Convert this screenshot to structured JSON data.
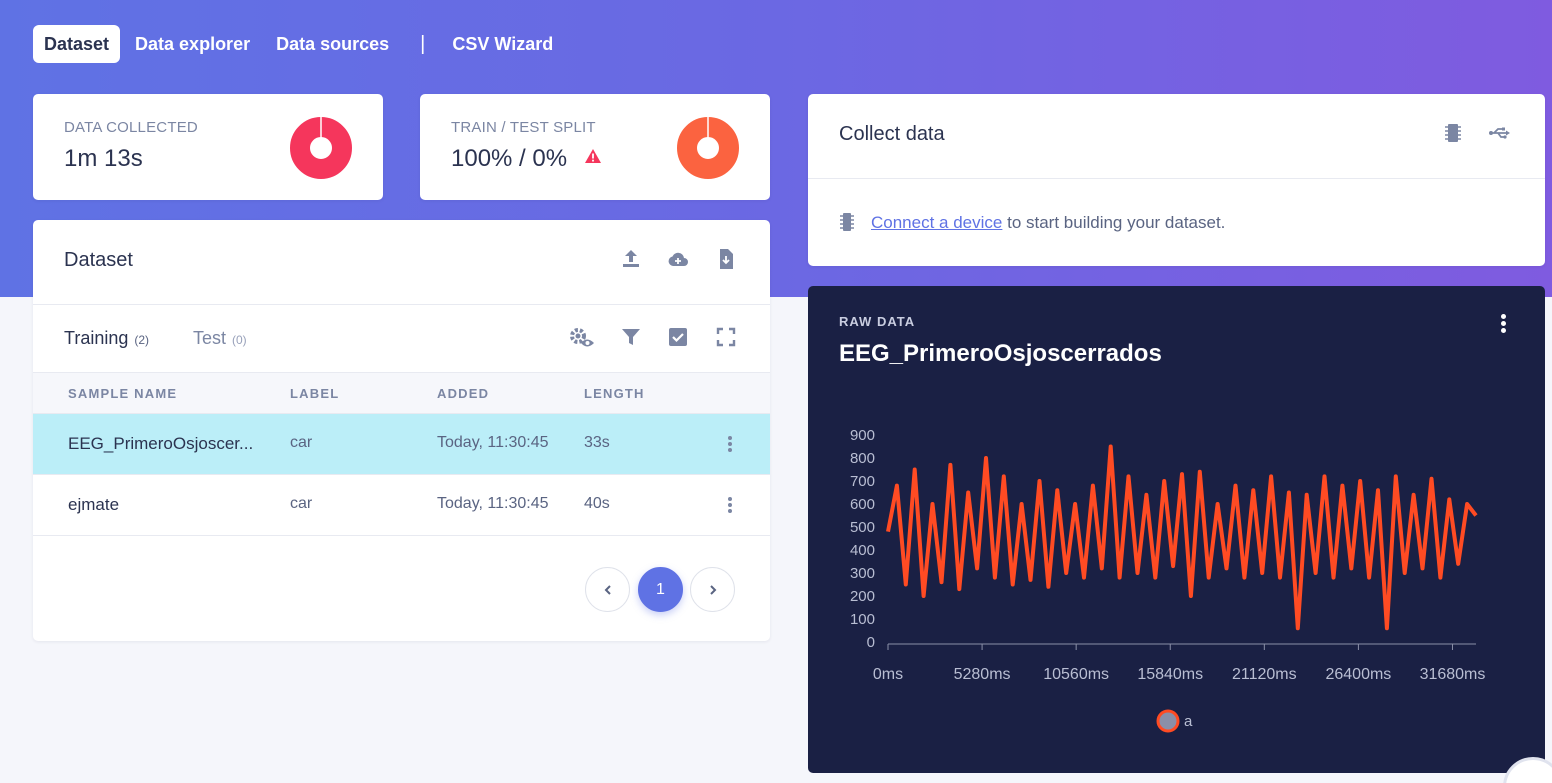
{
  "nav": {
    "tabs": [
      {
        "label": "Dataset",
        "active": true
      },
      {
        "label": "Data explorer",
        "active": false
      },
      {
        "label": "Data sources",
        "active": false
      },
      {
        "label": "CSV Wizard",
        "active": false
      }
    ],
    "separator": "|"
  },
  "stats": {
    "collected": {
      "label": "DATA COLLECTED",
      "value": "1m 13s",
      "color": "#f5365c"
    },
    "split": {
      "label": "TRAIN / TEST SPLIT",
      "value": "100% / 0%",
      "color": "#fb6340",
      "warning_color": "#f5365c"
    }
  },
  "dataset": {
    "title": "Dataset",
    "icons": [
      "upload-icon",
      "cloud-add-icon",
      "file-download-icon"
    ],
    "tabs": {
      "training": {
        "label": "Training",
        "count": "(2)"
      },
      "test": {
        "label": "Test",
        "count": "(0)"
      }
    },
    "toolbar_icons": [
      "settings-eye-icon",
      "filter-icon",
      "checkbox-icon",
      "fullscreen-icon"
    ],
    "columns": [
      "SAMPLE NAME",
      "LABEL",
      "ADDED",
      "LENGTH"
    ],
    "rows": [
      {
        "name": "EEG_PrimeroOsjoscer...",
        "label": "car",
        "added": "Today, 11:30:45",
        "length": "33s",
        "selected": true
      },
      {
        "name": "ejmate",
        "label": "car",
        "added": "Today, 11:30:45",
        "length": "40s",
        "selected": false
      }
    ],
    "pagination": {
      "current": "1"
    }
  },
  "collect": {
    "title": "Collect data",
    "icons": [
      "chip-icon",
      "usb-icon"
    ],
    "link_text": "Connect a device",
    "message": " to start building your dataset."
  },
  "raw": {
    "label": "RAW DATA",
    "title": "EEG_PrimeroOsjoscerrados"
  },
  "chart_data": {
    "type": "line",
    "title": "EEG_PrimeroOsjoscerrados",
    "xlabel": "",
    "ylabel": "",
    "ylim": [
      0,
      900
    ],
    "xlim": [
      0,
      33000
    ],
    "y_ticks": [
      "900",
      "800",
      "700",
      "600",
      "500",
      "400",
      "300",
      "200",
      "100",
      "0"
    ],
    "x_ticks": [
      "0ms",
      "5280ms",
      "10560ms",
      "15840ms",
      "21120ms",
      "26400ms",
      "31680ms"
    ],
    "series": [
      {
        "name": "a",
        "color": "#ff4b23",
        "x": [
          0,
          500,
          1000,
          1500,
          2000,
          2500,
          3000,
          3500,
          4000,
          4500,
          5000,
          5500,
          6000,
          6500,
          7000,
          7500,
          8000,
          8500,
          9000,
          9500,
          10000,
          10500,
          11000,
          11500,
          12000,
          12500,
          13000,
          13500,
          14000,
          14500,
          15000,
          15500,
          16000,
          16500,
          17000,
          17500,
          18000,
          18500,
          19000,
          19500,
          20000,
          20500,
          21000,
          21500,
          22000,
          22500,
          23000,
          23500,
          24000,
          24500,
          25000,
          25500,
          26000,
          26500,
          27000,
          27500,
          28000,
          28500,
          29000,
          29500,
          30000,
          30500,
          31000,
          31500,
          32000,
          32500,
          33000
        ],
        "y": [
          480,
          680,
          250,
          750,
          200,
          600,
          260,
          770,
          230,
          650,
          320,
          800,
          280,
          720,
          250,
          600,
          270,
          700,
          240,
          660,
          300,
          600,
          280,
          680,
          320,
          850,
          280,
          720,
          300,
          640,
          280,
          700,
          330,
          730,
          200,
          740,
          280,
          600,
          320,
          680,
          280,
          660,
          300,
          720,
          280,
          650,
          60,
          640,
          300,
          720,
          280,
          680,
          320,
          700,
          280,
          660,
          60,
          720,
          300,
          640,
          320,
          710,
          280,
          620,
          340,
          600,
          550
        ]
      }
    ],
    "legend": "bottom-center",
    "grid": false
  }
}
